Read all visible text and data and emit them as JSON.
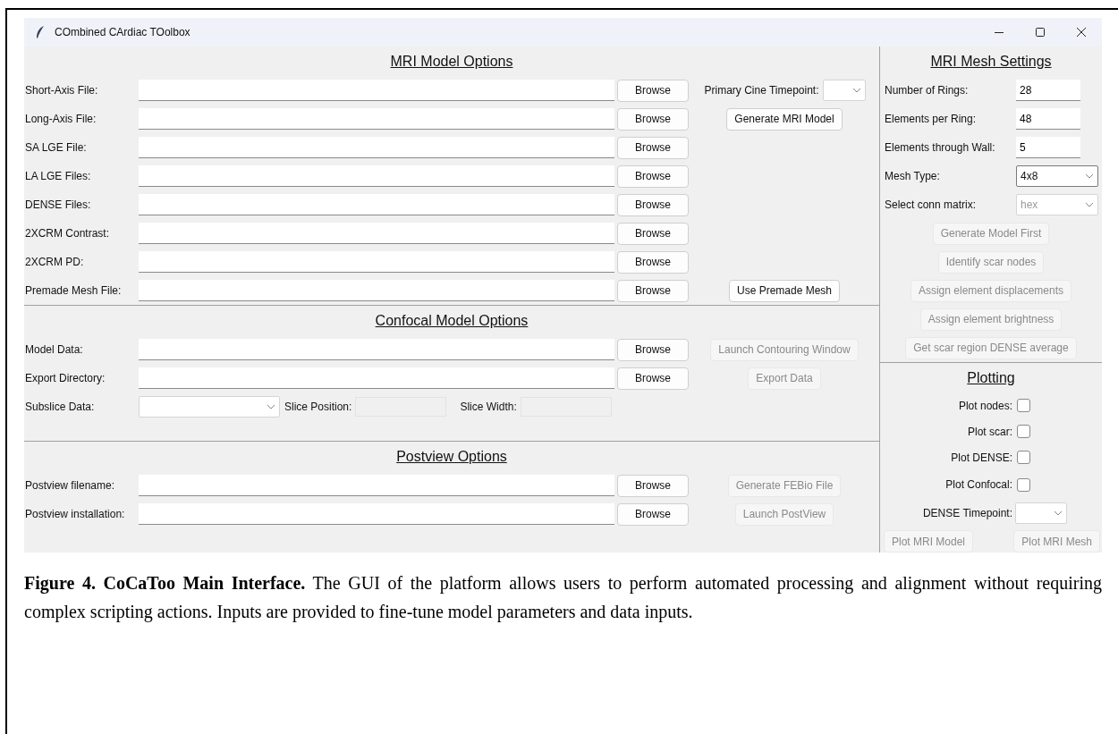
{
  "window": {
    "title": "COmbined CArdiac TOolbox"
  },
  "left_sections": [
    {
      "title": "MRI Model Options",
      "rows": [
        {
          "kind": "file",
          "label": "Short-Axis File:",
          "button": "Browse",
          "extra": {
            "kind": "dropdown",
            "label": "Primary Cine Timepoint:"
          }
        },
        {
          "kind": "file",
          "label": "Long-Axis File:",
          "button": "Browse",
          "extra": {
            "kind": "button",
            "label": "Generate MRI Model",
            "disabled": false
          }
        },
        {
          "kind": "file",
          "label": "SA LGE File:",
          "button": "Browse"
        },
        {
          "kind": "file",
          "label": "LA LGE Files:",
          "button": "Browse"
        },
        {
          "kind": "file",
          "label": "DENSE Files:",
          "button": "Browse"
        },
        {
          "kind": "file",
          "label": "2XCRM Contrast:",
          "button": "Browse"
        },
        {
          "kind": "file",
          "label": "2XCRM PD:",
          "button": "Browse"
        },
        {
          "kind": "file",
          "label": "Premade Mesh File:",
          "button": "Browse",
          "extra": {
            "kind": "button",
            "label": "Use Premade Mesh",
            "disabled": false
          }
        }
      ]
    },
    {
      "title": "Confocal Model Options",
      "rows": [
        {
          "kind": "file",
          "label": "Model Data:",
          "button": "Browse",
          "extra": {
            "kind": "button",
            "label": "Launch Contouring Window",
            "disabled": true
          }
        },
        {
          "kind": "file",
          "label": "Export Directory:",
          "button": "Browse",
          "extra": {
            "kind": "button",
            "label": "Export Data",
            "disabled": true
          }
        },
        {
          "kind": "subslice",
          "label": "Subslice Data:",
          "position_label": "Slice Position:",
          "position_disabled": true,
          "width_label": "Slice Width:",
          "width_disabled": true
        }
      ]
    },
    {
      "title": "Postview Options",
      "rows": [
        {
          "kind": "file",
          "label": "Postview filename:",
          "button": "Browse",
          "extra": {
            "kind": "button",
            "label": "Generate FEBio File",
            "disabled": true
          }
        },
        {
          "kind": "file",
          "label": "Postview installation:",
          "button": "Browse",
          "extra": {
            "kind": "button",
            "label": "Launch PostView",
            "disabled": true
          }
        }
      ]
    }
  ],
  "mesh_settings": {
    "title": "MRI Mesh Settings",
    "fields": [
      {
        "kind": "entry",
        "label": "Number of Rings:",
        "value": "28"
      },
      {
        "kind": "entry",
        "label": "Elements per Ring:",
        "value": "48"
      },
      {
        "kind": "entry",
        "label": "Elements through Wall:",
        "value": "5"
      },
      {
        "kind": "dropdown",
        "label": "Mesh Type:",
        "value": "4x8",
        "disabled": false
      },
      {
        "kind": "dropdown",
        "label": "Select conn matrix:",
        "value": "hex",
        "disabled": true
      }
    ],
    "actions": [
      {
        "label": "Generate Model First",
        "disabled": true
      },
      {
        "label": "Identify scar nodes",
        "disabled": true
      },
      {
        "label": "Assign element displacements",
        "disabled": true
      },
      {
        "label": "Assign element brightness",
        "disabled": true
      },
      {
        "label": "Get scar region DENSE average",
        "disabled": true
      }
    ]
  },
  "plotting": {
    "title": "Plotting",
    "checkboxes": [
      {
        "label": "Plot nodes:",
        "checked": false
      },
      {
        "label": "Plot scar:",
        "checked": false
      },
      {
        "label": "Plot DENSE:",
        "checked": false
      },
      {
        "label": "Plot Confocal:",
        "checked": false
      }
    ],
    "timepoint": {
      "label": "DENSE Timepoint:"
    },
    "buttons": [
      {
        "label": "Plot MRI Model",
        "disabled": true
      },
      {
        "label": "Plot MRI Mesh",
        "disabled": true
      }
    ]
  },
  "caption": "**Figure 4. CoCaToo Main Interface.** The GUI of the platform allows users to perform automated processing and alignment without requiring complex scripting actions. Inputs are provided to fine-tune model parameters and data inputs."
}
